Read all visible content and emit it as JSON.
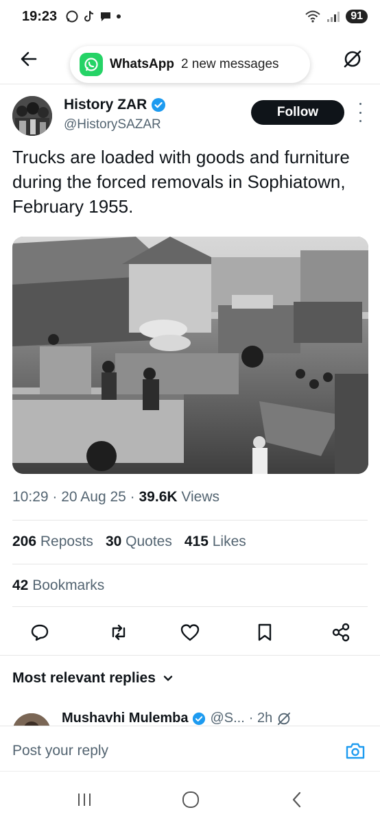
{
  "status_bar": {
    "time": "19:23",
    "battery": "91"
  },
  "notification": {
    "app": "WhatsApp",
    "message": "2 new messages"
  },
  "post": {
    "author_name": "History ZAR",
    "author_handle": "@HistorySAZAR",
    "follow_label": "Follow",
    "text": "Trucks are loaded with goods and furniture during the forced removals in Sophiatown, February 1955.",
    "time": "10:29",
    "date": "20 Aug 25",
    "views_count": "39.6K",
    "views_label": "Views",
    "reposts_count": "206",
    "reposts_label": "Reposts",
    "quotes_count": "30",
    "quotes_label": "Quotes",
    "likes_count": "415",
    "likes_label": "Likes",
    "bookmarks_count": "42",
    "bookmarks_label": "Bookmarks"
  },
  "replies": {
    "heading": "Most relevant replies",
    "first_reply": {
      "name": "Mushavhi Mulemba",
      "handle": "@S...",
      "time": "· 2h"
    }
  },
  "composer": {
    "placeholder": "Post your reply"
  },
  "icons": {
    "back": "arrow-left-icon",
    "grok": "grok-icon",
    "reply": "comment-icon",
    "repost": "repost-icon",
    "like": "heart-icon",
    "bookmark": "bookmark-icon",
    "share": "share-icon",
    "camera": "camera-icon"
  },
  "colors": {
    "accent": "#1d9bf0",
    "follow_bg": "#0f1419",
    "secondary_text": "#536471",
    "whatsapp": "#25d366"
  }
}
